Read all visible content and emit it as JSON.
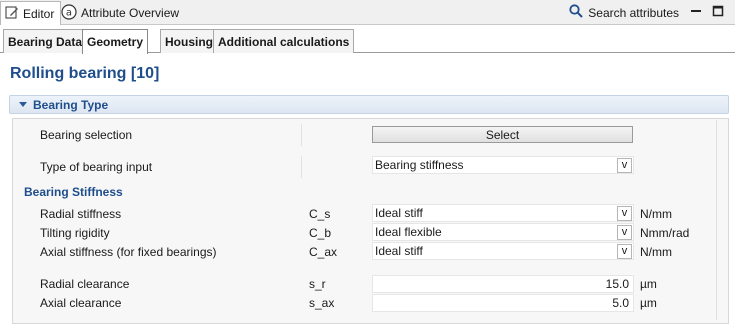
{
  "viewbar": {
    "tabs": [
      {
        "label": "Editor",
        "icon": "edit-icon"
      },
      {
        "label": "Attribute Overview",
        "icon": "attribute-icon"
      }
    ],
    "search_label": "Search attributes"
  },
  "subtabs": [
    "Bearing Data",
    "Geometry",
    "Housing",
    "Additional calculations"
  ],
  "active_subtab": "Geometry",
  "title": "Rolling bearing [10]",
  "section": {
    "label": "Bearing Type",
    "bearing_selection_label": "Bearing selection",
    "select_button": "Select",
    "input_type_label": "Type of bearing input",
    "input_type_value": "Bearing stiffness",
    "combo_arrow": "v"
  },
  "stiffness": {
    "heading": "Bearing Stiffness",
    "rows": [
      {
        "label": "Radial stiffness",
        "symbol": "C_s",
        "value": "Ideal stiff",
        "unit": "N/mm"
      },
      {
        "label": "Tilting rigidity",
        "symbol": "C_b",
        "value": "Ideal flexible",
        "unit": "Nmm/rad"
      },
      {
        "label": "Axial stiffness (for fixed bearings)",
        "symbol": "C_ax",
        "value": "Ideal stiff",
        "unit": "N/mm"
      }
    ]
  },
  "clearance": {
    "rows": [
      {
        "label": "Radial clearance",
        "symbol": "s_r",
        "value": "15.0",
        "unit": "µm"
      },
      {
        "label": "Axial clearance",
        "symbol": "s_ax",
        "value": "5.0",
        "unit": "µm"
      }
    ]
  },
  "colors": {
    "accent": "#1f4e8c",
    "header_bg": "#dde6f1"
  }
}
